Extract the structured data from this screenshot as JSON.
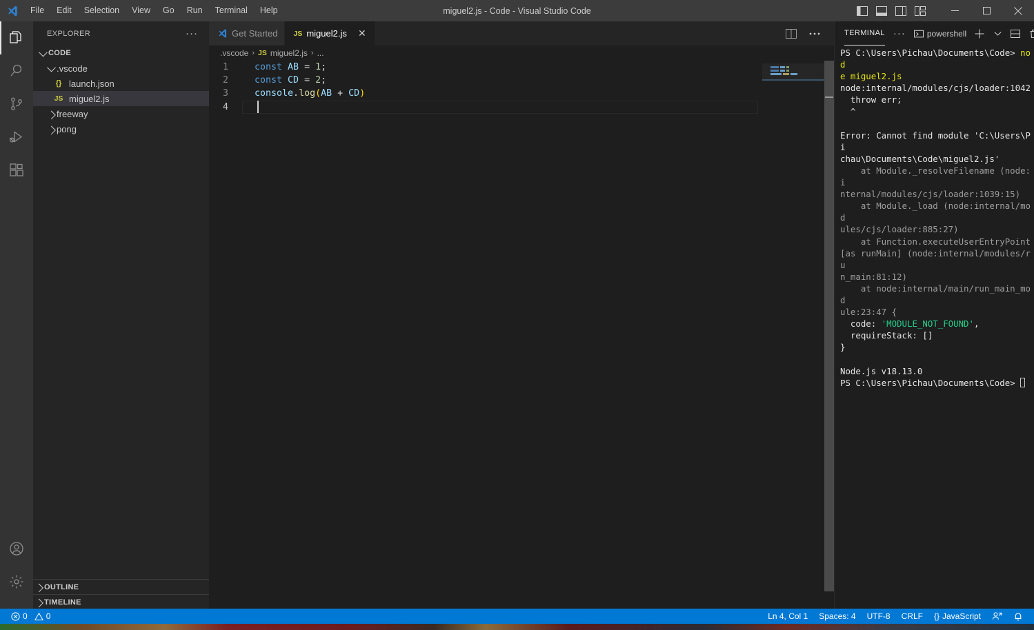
{
  "window": {
    "title": "miguel2.js - Code - Visual Studio Code",
    "menu": [
      "File",
      "Edit",
      "Selection",
      "View",
      "Go",
      "Run",
      "Terminal",
      "Help"
    ],
    "layout_buttons": [
      "toggle-primary-sidebar",
      "toggle-panel",
      "toggle-secondary-sidebar",
      "customize-layout"
    ],
    "controls": [
      "minimize",
      "maximize",
      "close"
    ]
  },
  "activitybar": {
    "items": [
      {
        "name": "explorer",
        "icon": "files-icon",
        "active": true
      },
      {
        "name": "search",
        "icon": "search-icon",
        "active": false
      },
      {
        "name": "source-control",
        "icon": "source-control-icon",
        "active": false
      },
      {
        "name": "run-and-debug",
        "icon": "run-debug-icon",
        "active": false
      },
      {
        "name": "extensions",
        "icon": "extensions-icon",
        "active": false
      }
    ],
    "bottom": [
      {
        "name": "accounts",
        "icon": "account-icon"
      },
      {
        "name": "manage",
        "icon": "gear-icon"
      }
    ]
  },
  "sidebar": {
    "title": "EXPLORER",
    "more_actions": "···",
    "tree": [
      {
        "label": "CODE",
        "type": "root-folder",
        "expanded": true,
        "depth": 0
      },
      {
        "label": ".vscode",
        "type": "folder",
        "expanded": true,
        "depth": 1
      },
      {
        "label": "launch.json",
        "type": "json-file",
        "icon": "{}",
        "depth": 2
      },
      {
        "label": "miguel2.js",
        "type": "js-file",
        "icon": "JS",
        "depth": 2,
        "selected": true
      },
      {
        "label": "freeway",
        "type": "folder",
        "expanded": false,
        "depth": 1
      },
      {
        "label": "pong",
        "type": "folder",
        "expanded": false,
        "depth": 1
      }
    ],
    "sections": [
      "OUTLINE",
      "TIMELINE"
    ]
  },
  "editor": {
    "tabs": [
      {
        "label": "Get Started",
        "icon": "vscode-icon",
        "active": false,
        "closable": false
      },
      {
        "label": "miguel2.js",
        "icon": "JS",
        "active": true,
        "closable": true,
        "close_glyph": "✕"
      }
    ],
    "actions": [
      "split-editor",
      "more-actions"
    ],
    "breadcrumbs": [
      ".vscode",
      "miguel2.js",
      "..."
    ],
    "breadcrumb_file_icon": "JS",
    "lines": [
      {
        "num": "1",
        "tokens": [
          {
            "t": "const",
            "c": "kw"
          },
          {
            "t": " ",
            "c": "plain"
          },
          {
            "t": "AB",
            "c": "var"
          },
          {
            "t": " ",
            "c": "plain"
          },
          {
            "t": "=",
            "c": "op"
          },
          {
            "t": " ",
            "c": "plain"
          },
          {
            "t": "1",
            "c": "num"
          },
          {
            "t": ";",
            "c": "op"
          }
        ]
      },
      {
        "num": "2",
        "tokens": [
          {
            "t": "const",
            "c": "kw"
          },
          {
            "t": " ",
            "c": "plain"
          },
          {
            "t": "CD",
            "c": "var"
          },
          {
            "t": " ",
            "c": "plain"
          },
          {
            "t": "=",
            "c": "op"
          },
          {
            "t": " ",
            "c": "plain"
          },
          {
            "t": "2",
            "c": "num"
          },
          {
            "t": ";",
            "c": "op"
          }
        ]
      },
      {
        "num": "3",
        "tokens": [
          {
            "t": "console",
            "c": "var"
          },
          {
            "t": ".",
            "c": "op"
          },
          {
            "t": "log",
            "c": "fn"
          },
          {
            "t": "(",
            "c": "paren"
          },
          {
            "t": "AB",
            "c": "var"
          },
          {
            "t": " ",
            "c": "plain"
          },
          {
            "t": "+",
            "c": "op"
          },
          {
            "t": " ",
            "c": "plain"
          },
          {
            "t": "CD",
            "c": "var"
          },
          {
            "t": ")",
            "c": "paren"
          }
        ]
      },
      {
        "num": "4",
        "tokens": []
      }
    ],
    "cursor_line": 4
  },
  "panel": {
    "tab_label": "TERMINAL",
    "more_actions": "···",
    "shell_name": "powershell",
    "actions": [
      "new-terminal",
      "terminal-dropdown",
      "split-terminal",
      "kill-terminal"
    ],
    "terminal_lines": [
      [
        {
          "t": "PS C:\\Users\\Pichau\\Documents\\Code> ",
          "c": "t-white"
        },
        {
          "t": "nod",
          "c": "t-yellow"
        }
      ],
      [
        {
          "t": "e miguel2.js",
          "c": "t-yellow"
        }
      ],
      [
        {
          "t": "node:internal/modules/cjs/loader:1042",
          "c": "t-white"
        }
      ],
      [
        {
          "t": "  throw err;",
          "c": "t-white"
        }
      ],
      [
        {
          "t": "  ^",
          "c": "t-white"
        }
      ],
      [
        {
          "t": "",
          "c": "t-white"
        }
      ],
      [
        {
          "t": "Error: Cannot find module 'C:\\Users\\Pi",
          "c": "t-white"
        }
      ],
      [
        {
          "t": "chau\\Documents\\Code\\miguel2.js'",
          "c": "t-white"
        }
      ],
      [
        {
          "t": "    at Module._resolveFilename (node:i",
          "c": "t-gray"
        }
      ],
      [
        {
          "t": "nternal/modules/cjs/loader:1039:15)",
          "c": "t-gray"
        }
      ],
      [
        {
          "t": "    at Module._load (node:internal/mod",
          "c": "t-gray"
        }
      ],
      [
        {
          "t": "ules/cjs/loader:885:27)",
          "c": "t-gray"
        }
      ],
      [
        {
          "t": "    at Function.executeUserEntryPoint",
          "c": "t-gray"
        }
      ],
      [
        {
          "t": "[as runMain] (node:internal/modules/ru",
          "c": "t-gray"
        }
      ],
      [
        {
          "t": "n_main:81:12)",
          "c": "t-gray"
        }
      ],
      [
        {
          "t": "    at node:internal/main/run_main_mod",
          "c": "t-gray"
        }
      ],
      [
        {
          "t": "ule:23:47 {",
          "c": "t-gray"
        }
      ],
      [
        {
          "t": "  code: ",
          "c": "t-white"
        },
        {
          "t": "'MODULE_NOT_FOUND'",
          "c": "t-green"
        },
        {
          "t": ",",
          "c": "t-white"
        }
      ],
      [
        {
          "t": "  requireStack: []",
          "c": "t-white"
        }
      ],
      [
        {
          "t": "}",
          "c": "t-white"
        }
      ],
      [
        {
          "t": "",
          "c": "t-white"
        }
      ],
      [
        {
          "t": "Node.js v18.13.0",
          "c": "t-white"
        }
      ],
      [
        {
          "t": "PS C:\\Users\\Pichau\\Documents\\Code> ",
          "c": "t-white"
        }
      ]
    ]
  },
  "statusbar": {
    "errors": "0",
    "warnings": "0",
    "position": "Ln 4, Col 1",
    "indentation": "Spaces: 4",
    "encoding": "UTF-8",
    "eol": "CRLF",
    "language": "JavaScript",
    "language_icon": "{}",
    "right_icons": [
      "remote-icon",
      "notifications-bell-icon"
    ],
    "accent_color": "#0078d4"
  }
}
